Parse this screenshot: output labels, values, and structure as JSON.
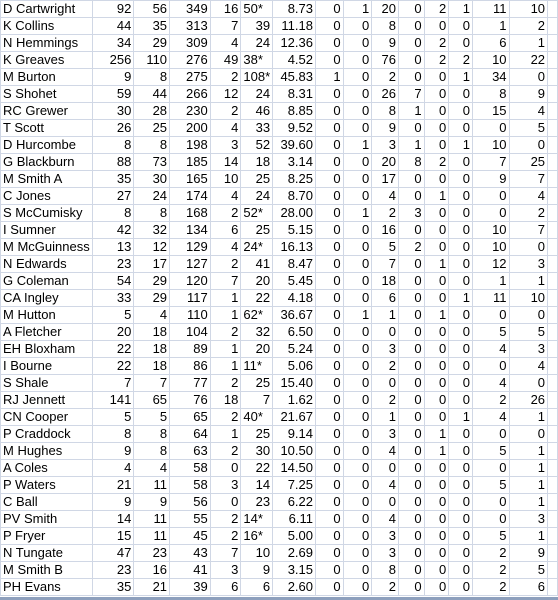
{
  "sheet": {
    "rows": [
      [
        "D Cartwright",
        "92",
        "56",
        "349",
        "16",
        "50*",
        "8.73",
        "0",
        "1",
        "20",
        "0",
        "2",
        "1",
        "11",
        "10"
      ],
      [
        "K Collins",
        "44",
        "35",
        "313",
        "7",
        "39",
        "11.18",
        "0",
        "0",
        "8",
        "0",
        "0",
        "0",
        "1",
        "2"
      ],
      [
        "N Hemmings",
        "34",
        "29",
        "309",
        "4",
        "24",
        "12.36",
        "0",
        "0",
        "9",
        "0",
        "2",
        "0",
        "6",
        "1"
      ],
      [
        "K Greaves",
        "256",
        "110",
        "276",
        "49",
        "38*",
        "4.52",
        "0",
        "0",
        "76",
        "0",
        "2",
        "2",
        "10",
        "22"
      ],
      [
        "M Burton",
        "9",
        "8",
        "275",
        "2",
        "108*",
        "45.83",
        "1",
        "0",
        "2",
        "0",
        "0",
        "1",
        "34",
        "0"
      ],
      [
        "S Shohet",
        "59",
        "44",
        "266",
        "12",
        "24",
        "8.31",
        "0",
        "0",
        "26",
        "7",
        "0",
        "0",
        "8",
        "9"
      ],
      [
        "RC Grewer",
        "30",
        "28",
        "230",
        "2",
        "46",
        "8.85",
        "0",
        "0",
        "8",
        "1",
        "0",
        "0",
        "15",
        "4"
      ],
      [
        "T Scott",
        "26",
        "25",
        "200",
        "4",
        "33",
        "9.52",
        "0",
        "0",
        "9",
        "0",
        "0",
        "0",
        "0",
        "5"
      ],
      [
        "D Hurcombe",
        "8",
        "8",
        "198",
        "3",
        "52",
        "39.60",
        "0",
        "1",
        "3",
        "1",
        "0",
        "1",
        "10",
        "0"
      ],
      [
        "G Blackburn",
        "88",
        "73",
        "185",
        "14",
        "18",
        "3.14",
        "0",
        "0",
        "20",
        "8",
        "2",
        "0",
        "7",
        "25"
      ],
      [
        "M Smith A",
        "35",
        "30",
        "165",
        "10",
        "25",
        "8.25",
        "0",
        "0",
        "17",
        "0",
        "0",
        "0",
        "9",
        "7"
      ],
      [
        "C Jones",
        "27",
        "24",
        "174",
        "4",
        "24",
        "8.70",
        "0",
        "0",
        "4",
        "0",
        "1",
        "0",
        "0",
        "4"
      ],
      [
        "S McCumisky",
        "8",
        "8",
        "168",
        "2",
        "52*",
        "28.00",
        "0",
        "1",
        "2",
        "3",
        "0",
        "0",
        "0",
        "2"
      ],
      [
        "I Sumner",
        "42",
        "32",
        "134",
        "6",
        "25",
        "5.15",
        "0",
        "0",
        "16",
        "0",
        "0",
        "0",
        "10",
        "7"
      ],
      [
        "M McGuinness",
        "13",
        "12",
        "129",
        "4",
        "24*",
        "16.13",
        "0",
        "0",
        "5",
        "2",
        "0",
        "0",
        "10",
        "0"
      ],
      [
        "N Edwards",
        "23",
        "17",
        "127",
        "2",
        "41",
        "8.47",
        "0",
        "0",
        "7",
        "0",
        "1",
        "0",
        "12",
        "3"
      ],
      [
        "G Coleman",
        "54",
        "29",
        "120",
        "7",
        "20",
        "5.45",
        "0",
        "0",
        "18",
        "0",
        "0",
        "0",
        "1",
        "1"
      ],
      [
        "CA Ingley",
        "33",
        "29",
        "117",
        "1",
        "22",
        "4.18",
        "0",
        "0",
        "6",
        "0",
        "0",
        "1",
        "11",
        "10"
      ],
      [
        "M Hutton",
        "5",
        "4",
        "110",
        "1",
        "62*",
        "36.67",
        "0",
        "1",
        "1",
        "0",
        "1",
        "0",
        "0",
        "0"
      ],
      [
        "A Fletcher",
        "20",
        "18",
        "104",
        "2",
        "32",
        "6.50",
        "0",
        "0",
        "0",
        "0",
        "0",
        "0",
        "5",
        "5"
      ],
      [
        "EH Bloxham",
        "22",
        "18",
        "89",
        "1",
        "20",
        "5.24",
        "0",
        "0",
        "3",
        "0",
        "0",
        "0",
        "4",
        "3"
      ],
      [
        "I Bourne",
        "22",
        "18",
        "86",
        "1",
        "11*",
        "5.06",
        "0",
        "0",
        "2",
        "0",
        "0",
        "0",
        "0",
        "4"
      ],
      [
        "S Shale",
        "7",
        "7",
        "77",
        "2",
        "25",
        "15.40",
        "0",
        "0",
        "0",
        "0",
        "0",
        "0",
        "4",
        "0"
      ],
      [
        "RJ Jennett",
        "141",
        "65",
        "76",
        "18",
        "7",
        "1.62",
        "0",
        "0",
        "2",
        "0",
        "0",
        "0",
        "2",
        "26"
      ],
      [
        "CN Cooper",
        "5",
        "5",
        "65",
        "2",
        "40*",
        "21.67",
        "0",
        "0",
        "1",
        "0",
        "0",
        "1",
        "4",
        "1"
      ],
      [
        "P Craddock",
        "8",
        "8",
        "64",
        "1",
        "25",
        "9.14",
        "0",
        "0",
        "3",
        "0",
        "1",
        "0",
        "0",
        "0"
      ],
      [
        "M Hughes",
        "9",
        "8",
        "63",
        "2",
        "30",
        "10.50",
        "0",
        "0",
        "4",
        "0",
        "1",
        "0",
        "5",
        "1"
      ],
      [
        "A Coles",
        "4",
        "4",
        "58",
        "0",
        "22",
        "14.50",
        "0",
        "0",
        "0",
        "0",
        "0",
        "0",
        "0",
        "1"
      ],
      [
        "P Waters",
        "21",
        "11",
        "58",
        "3",
        "14",
        "7.25",
        "0",
        "0",
        "4",
        "0",
        "0",
        "0",
        "5",
        "1"
      ],
      [
        "C Ball",
        "9",
        "9",
        "56",
        "0",
        "23",
        "6.22",
        "0",
        "0",
        "0",
        "0",
        "0",
        "0",
        "0",
        "1"
      ],
      [
        "PV Smith",
        "14",
        "11",
        "55",
        "2",
        "14*",
        "6.11",
        "0",
        "0",
        "4",
        "0",
        "0",
        "0",
        "0",
        "3"
      ],
      [
        "P Fryer",
        "15",
        "11",
        "45",
        "2",
        "16*",
        "5.00",
        "0",
        "0",
        "3",
        "0",
        "0",
        "0",
        "5",
        "1"
      ],
      [
        "N Tungate",
        "47",
        "23",
        "43",
        "7",
        "10",
        "2.69",
        "0",
        "0",
        "3",
        "0",
        "0",
        "0",
        "2",
        "9"
      ],
      [
        "M Smith B",
        "23",
        "16",
        "41",
        "3",
        "9",
        "3.15",
        "0",
        "0",
        "8",
        "0",
        "0",
        "0",
        "2",
        "5"
      ],
      [
        "PH Evans",
        "35",
        "21",
        "39",
        "6",
        "6",
        "2.60",
        "0",
        "0",
        "2",
        "0",
        "0",
        "0",
        "2",
        "6"
      ]
    ]
  }
}
